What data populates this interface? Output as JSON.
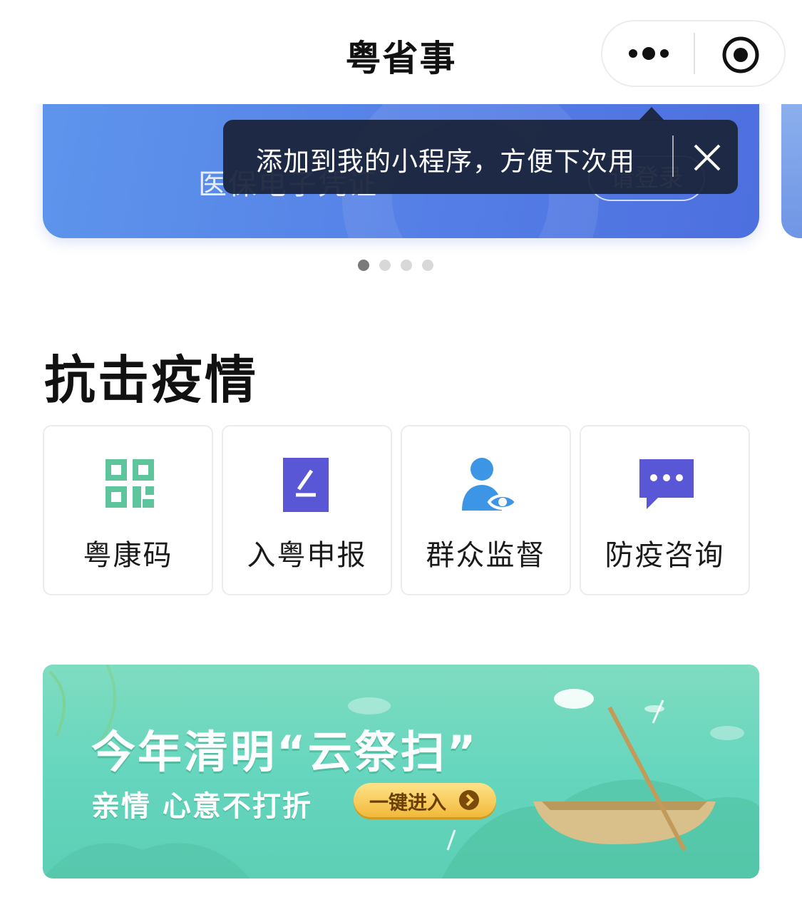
{
  "navbar": {
    "title": "粤省事",
    "more_icon": "more-dots-icon",
    "close_icon": "circle-target-icon"
  },
  "banner": {
    "label": "医保电子凭证",
    "login_button": "请登录",
    "accent_color": "#557fe6"
  },
  "tooltip": {
    "text": "添加到我的小程序，方便下次用",
    "close_icon": "close-icon"
  },
  "pager": {
    "total": 4,
    "active": 1
  },
  "section": {
    "title": "抗击疫情",
    "items": [
      {
        "label": "粤康码",
        "icon": "qr-code-icon",
        "color": "#5ec49c"
      },
      {
        "label": "入粤申报",
        "icon": "edit-form-icon",
        "color": "#5a57d6"
      },
      {
        "label": "群众监督",
        "icon": "person-eye-icon",
        "color": "#3d95e6"
      },
      {
        "label": "防疫咨询",
        "icon": "chat-bubble-icon",
        "color": "#5a57d6"
      }
    ]
  },
  "promo": {
    "title": "今年清明“云祭扫”",
    "subtitle": "亲情  心意不打折",
    "cta": "一键进入",
    "bg_color": "#66d6be"
  }
}
